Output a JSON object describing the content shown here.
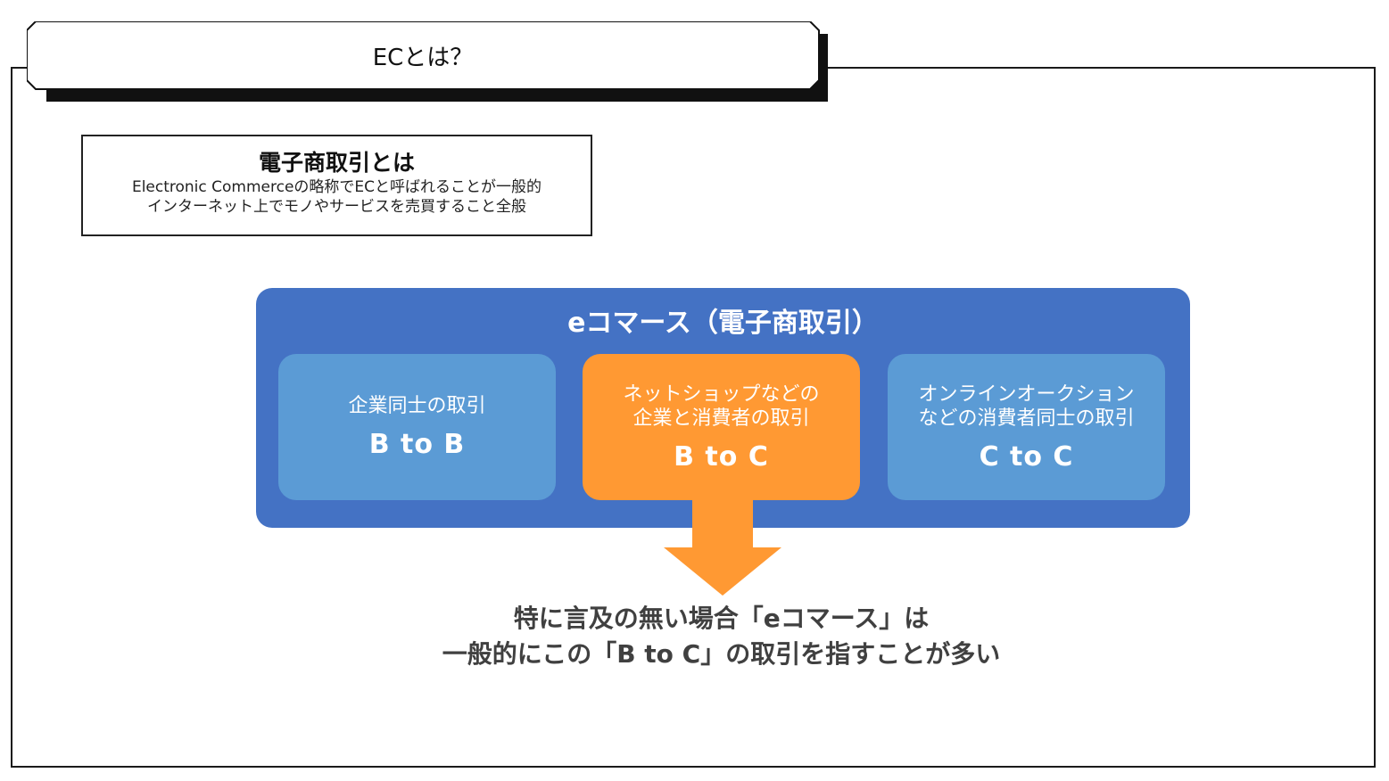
{
  "header": {
    "title": "ECとは？"
  },
  "definition": {
    "heading": "電子商取引とは",
    "lines": [
      "Electronic Commerceの略称でECと呼ばれることが一般的",
      "インターネット上でモノやサービスを売買すること全般"
    ]
  },
  "ecommerce": {
    "title": "eコマース（電子商取引）",
    "cards": [
      {
        "description": "企業同士の取引",
        "label": "B to B",
        "color": "#5b9bd5"
      },
      {
        "description": "ネットショップなどの\n企業と消費者の取引",
        "label": "B to C",
        "color": "#ff9933"
      },
      {
        "description": "オンラインオークション\nなどの消費者同士の取引",
        "label": "C to C",
        "color": "#5b9bd5"
      }
    ]
  },
  "note": {
    "lines": [
      "特に言及の無い場合「eコマース」は",
      "一般的にこの「B to C」の取引を指すことが多い"
    ]
  },
  "colors": {
    "panel": "#4472c4",
    "card_blue": "#5b9bd5",
    "card_orange": "#ff9933",
    "arrow": "#ff9933",
    "note_text": "#404040"
  }
}
